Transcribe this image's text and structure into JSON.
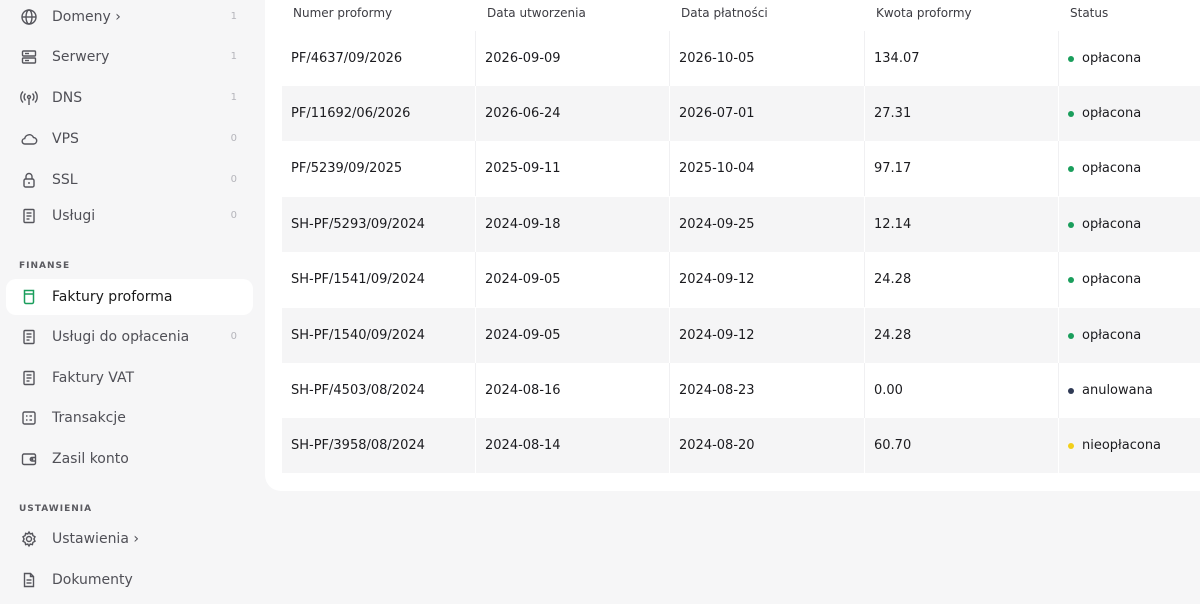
{
  "sidebar": {
    "items_top": [
      {
        "label": "Domeny ›",
        "count": "1",
        "icon": "globe-icon"
      },
      {
        "label": "Serwery",
        "count": "1",
        "icon": "server-icon"
      },
      {
        "label": "DNS",
        "count": "1",
        "icon": "antenna-icon"
      },
      {
        "label": "VPS",
        "count": "0",
        "icon": "cloud-icon"
      },
      {
        "label": "SSL",
        "count": "0",
        "icon": "lock-icon"
      },
      {
        "label": "Usługi",
        "count": "0",
        "icon": "document-icon"
      }
    ],
    "finance_title": "FINANSE",
    "finance_items": [
      {
        "label": "Faktury proforma",
        "count": "",
        "icon": "proforma-icon"
      },
      {
        "label": "Usługi do opłacenia",
        "count": "0",
        "icon": "document-icon"
      },
      {
        "label": "Faktury VAT",
        "count": "",
        "icon": "document-icon"
      },
      {
        "label": "Transakcje",
        "count": "",
        "icon": "transactions-icon"
      },
      {
        "label": "Zasil konto",
        "count": "",
        "icon": "wallet-icon"
      }
    ],
    "settings_title": "USTAWIENIA",
    "settings_items": [
      {
        "label": "Ustawienia ›",
        "count": "",
        "icon": "gear-icon"
      },
      {
        "label": "Dokumenty",
        "count": "",
        "icon": "file-icon"
      }
    ]
  },
  "table": {
    "headers": [
      "Numer proformy",
      "Data utworzenia",
      "Data płatności",
      "Kwota proformy",
      "Status"
    ],
    "rows": [
      {
        "number": "PF/4637/09/2026",
        "created": "2026-09-09",
        "due": "2026-10-05",
        "amount": "134.07",
        "status": "opłacona"
      },
      {
        "number": "PF/11692/06/2026",
        "created": "2026-06-24",
        "due": "2026-07-01",
        "amount": "27.31",
        "status": "opłacona"
      },
      {
        "number": "PF/5239/09/2025",
        "created": "2025-09-11",
        "due": "2025-10-04",
        "amount": "97.17",
        "status": "opłacona"
      },
      {
        "number": "SH-PF/5293/09/2024",
        "created": "2024-09-18",
        "due": "2024-09-25",
        "amount": "12.14",
        "status": "opłacona"
      },
      {
        "number": "SH-PF/1541/09/2024",
        "created": "2024-09-05",
        "due": "2024-09-12",
        "amount": "24.28",
        "status": "opłacona"
      },
      {
        "number": "SH-PF/1540/09/2024",
        "created": "2024-09-05",
        "due": "2024-09-12",
        "amount": "24.28",
        "status": "opłacona"
      },
      {
        "number": "SH-PF/4503/08/2024",
        "created": "2024-08-16",
        "due": "2024-08-23",
        "amount": "0.00",
        "status": "anulowana"
      },
      {
        "number": "SH-PF/3958/08/2024",
        "created": "2024-08-14",
        "due": "2024-08-20",
        "amount": "60.70",
        "status": "nieopłacona"
      }
    ]
  },
  "colors": {
    "paid": "#1a9e5c",
    "cancelled": "#2f3a55",
    "unpaid": "#f2cf1a",
    "active_accent": "#1a9e5c"
  }
}
